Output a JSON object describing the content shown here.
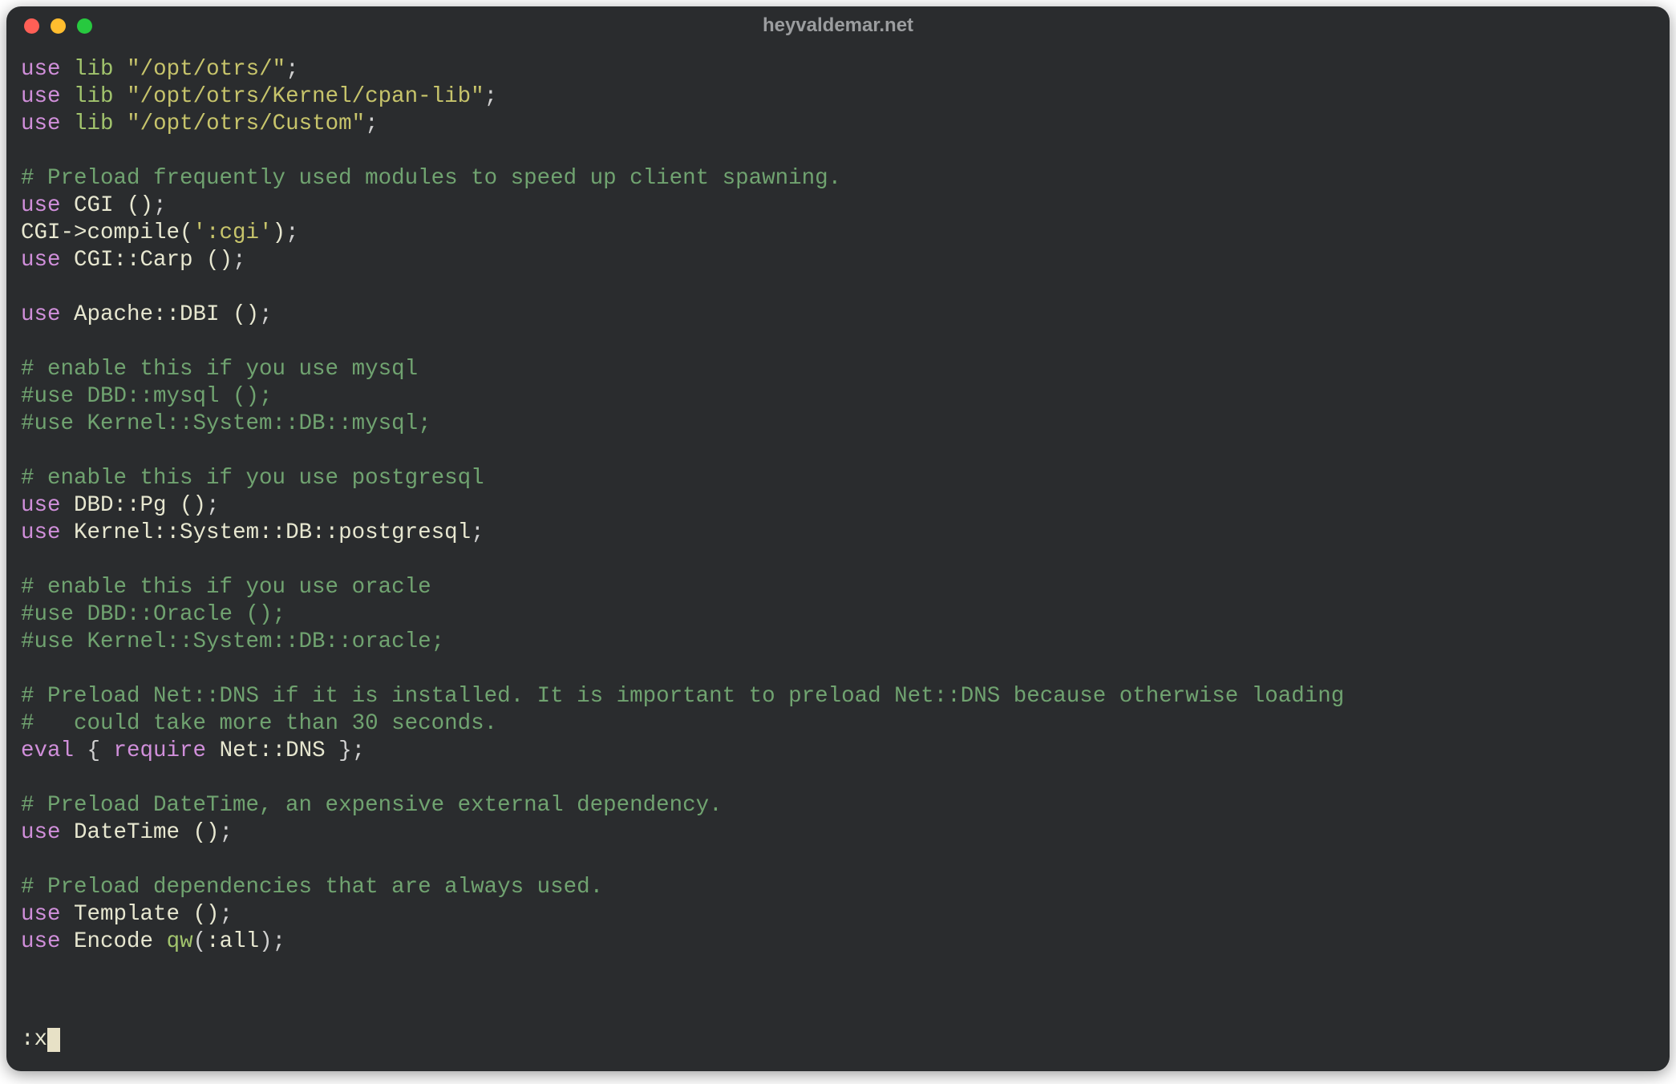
{
  "window": {
    "title": "heyvaldemar.net"
  },
  "code": {
    "lines": [
      [
        [
          "kw",
          "use"
        ],
        [
          "op",
          " "
        ],
        [
          "lib",
          "lib"
        ],
        [
          "op",
          " "
        ],
        [
          "str",
          "\"/opt/otrs/\""
        ],
        [
          "op",
          ";"
        ]
      ],
      [
        [
          "kw",
          "use"
        ],
        [
          "op",
          " "
        ],
        [
          "lib",
          "lib"
        ],
        [
          "op",
          " "
        ],
        [
          "str",
          "\"/opt/otrs/Kernel/cpan-lib\""
        ],
        [
          "op",
          ";"
        ]
      ],
      [
        [
          "kw",
          "use"
        ],
        [
          "op",
          " "
        ],
        [
          "lib",
          "lib"
        ],
        [
          "op",
          " "
        ],
        [
          "str",
          "\"/opt/otrs/Custom\""
        ],
        [
          "op",
          ";"
        ]
      ],
      [],
      [
        [
          "cmt",
          "# Preload frequently used modules to speed up client spawning."
        ]
      ],
      [
        [
          "kw",
          "use"
        ],
        [
          "op",
          " "
        ],
        [
          "pkg",
          "CGI ()"
        ],
        [
          "op",
          ";"
        ]
      ],
      [
        [
          "pkg",
          "CGI->compile("
        ],
        [
          "str",
          "':cgi'"
        ],
        [
          "pkg",
          ")"
        ],
        [
          "op",
          ";"
        ]
      ],
      [
        [
          "kw",
          "use"
        ],
        [
          "op",
          " "
        ],
        [
          "pkg",
          "CGI::Carp ()"
        ],
        [
          "op",
          ";"
        ]
      ],
      [],
      [
        [
          "kw",
          "use"
        ],
        [
          "op",
          " "
        ],
        [
          "pkg",
          "Apache::DBI ()"
        ],
        [
          "op",
          ";"
        ]
      ],
      [],
      [
        [
          "cmt",
          "# enable this if you use mysql"
        ]
      ],
      [
        [
          "cmt",
          "#use DBD::mysql ();"
        ]
      ],
      [
        [
          "cmt",
          "#use Kernel::System::DB::mysql;"
        ]
      ],
      [],
      [
        [
          "cmt",
          "# enable this if you use postgresql"
        ]
      ],
      [
        [
          "kw",
          "use"
        ],
        [
          "op",
          " "
        ],
        [
          "pkg",
          "DBD::Pg ()"
        ],
        [
          "op",
          ";"
        ]
      ],
      [
        [
          "kw",
          "use"
        ],
        [
          "op",
          " "
        ],
        [
          "pkg",
          "Kernel::System::DB::postgresql"
        ],
        [
          "op",
          ";"
        ]
      ],
      [],
      [
        [
          "cmt",
          "# enable this if you use oracle"
        ]
      ],
      [
        [
          "cmt",
          "#use DBD::Oracle ();"
        ]
      ],
      [
        [
          "cmt",
          "#use Kernel::System::DB::oracle;"
        ]
      ],
      [],
      [
        [
          "cmt",
          "# Preload Net::DNS if it is installed. It is important to preload Net::DNS because otherwise loading"
        ]
      ],
      [
        [
          "cmt",
          "#   could take more than 30 seconds."
        ]
      ],
      [
        [
          "kw",
          "eval"
        ],
        [
          "op",
          " { "
        ],
        [
          "kw",
          "require"
        ],
        [
          "op",
          " "
        ],
        [
          "pkg",
          "Net::DNS"
        ],
        [
          "op",
          " };"
        ]
      ],
      [],
      [
        [
          "cmt",
          "# Preload DateTime, an expensive external dependency."
        ]
      ],
      [
        [
          "kw",
          "use"
        ],
        [
          "op",
          " "
        ],
        [
          "pkg",
          "DateTime ()"
        ],
        [
          "op",
          ";"
        ]
      ],
      [],
      [
        [
          "cmt",
          "# Preload dependencies that are always used."
        ]
      ],
      [
        [
          "kw",
          "use"
        ],
        [
          "op",
          " "
        ],
        [
          "pkg",
          "Template ()"
        ],
        [
          "op",
          ";"
        ]
      ],
      [
        [
          "kw",
          "use"
        ],
        [
          "op",
          " "
        ],
        [
          "pkg",
          "Encode "
        ],
        [
          "lib",
          "qw"
        ],
        [
          "op",
          "("
        ],
        [
          "pkg",
          ":all"
        ],
        [
          "op",
          ");"
        ]
      ]
    ]
  },
  "command_line": {
    "text": ":x"
  }
}
